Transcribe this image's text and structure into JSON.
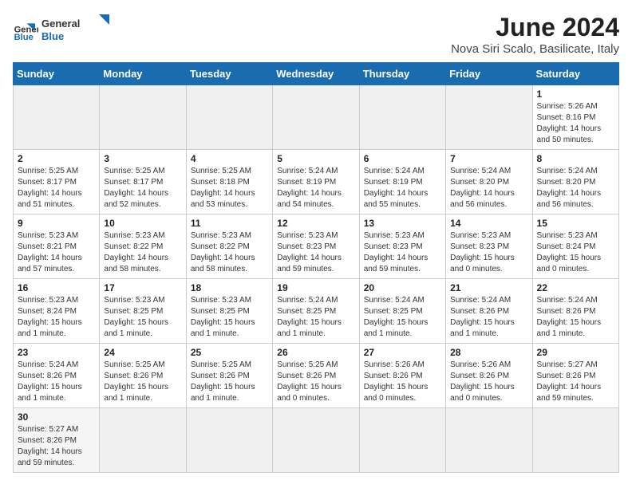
{
  "header": {
    "logo_general": "General",
    "logo_blue": "Blue",
    "title": "June 2024",
    "subtitle": "Nova Siri Scalo, Basilicate, Italy"
  },
  "weekdays": [
    "Sunday",
    "Monday",
    "Tuesday",
    "Wednesday",
    "Thursday",
    "Friday",
    "Saturday"
  ],
  "weeks": [
    [
      {
        "day": "",
        "info": ""
      },
      {
        "day": "",
        "info": ""
      },
      {
        "day": "",
        "info": ""
      },
      {
        "day": "",
        "info": ""
      },
      {
        "day": "",
        "info": ""
      },
      {
        "day": "",
        "info": ""
      },
      {
        "day": "1",
        "info": "Sunrise: 5:26 AM\nSunset: 8:16 PM\nDaylight: 14 hours\nand 50 minutes."
      }
    ],
    [
      {
        "day": "2",
        "info": "Sunrise: 5:25 AM\nSunset: 8:17 PM\nDaylight: 14 hours\nand 51 minutes."
      },
      {
        "day": "3",
        "info": "Sunrise: 5:25 AM\nSunset: 8:17 PM\nDaylight: 14 hours\nand 52 minutes."
      },
      {
        "day": "4",
        "info": "Sunrise: 5:25 AM\nSunset: 8:18 PM\nDaylight: 14 hours\nand 53 minutes."
      },
      {
        "day": "5",
        "info": "Sunrise: 5:24 AM\nSunset: 8:19 PM\nDaylight: 14 hours\nand 54 minutes."
      },
      {
        "day": "6",
        "info": "Sunrise: 5:24 AM\nSunset: 8:19 PM\nDaylight: 14 hours\nand 55 minutes."
      },
      {
        "day": "7",
        "info": "Sunrise: 5:24 AM\nSunset: 8:20 PM\nDaylight: 14 hours\nand 56 minutes."
      },
      {
        "day": "8",
        "info": "Sunrise: 5:24 AM\nSunset: 8:20 PM\nDaylight: 14 hours\nand 56 minutes."
      }
    ],
    [
      {
        "day": "9",
        "info": "Sunrise: 5:23 AM\nSunset: 8:21 PM\nDaylight: 14 hours\nand 57 minutes."
      },
      {
        "day": "10",
        "info": "Sunrise: 5:23 AM\nSunset: 8:22 PM\nDaylight: 14 hours\nand 58 minutes."
      },
      {
        "day": "11",
        "info": "Sunrise: 5:23 AM\nSunset: 8:22 PM\nDaylight: 14 hours\nand 58 minutes."
      },
      {
        "day": "12",
        "info": "Sunrise: 5:23 AM\nSunset: 8:23 PM\nDaylight: 14 hours\nand 59 minutes."
      },
      {
        "day": "13",
        "info": "Sunrise: 5:23 AM\nSunset: 8:23 PM\nDaylight: 14 hours\nand 59 minutes."
      },
      {
        "day": "14",
        "info": "Sunrise: 5:23 AM\nSunset: 8:23 PM\nDaylight: 15 hours\nand 0 minutes."
      },
      {
        "day": "15",
        "info": "Sunrise: 5:23 AM\nSunset: 8:24 PM\nDaylight: 15 hours\nand 0 minutes."
      }
    ],
    [
      {
        "day": "16",
        "info": "Sunrise: 5:23 AM\nSunset: 8:24 PM\nDaylight: 15 hours\nand 1 minute."
      },
      {
        "day": "17",
        "info": "Sunrise: 5:23 AM\nSunset: 8:25 PM\nDaylight: 15 hours\nand 1 minute."
      },
      {
        "day": "18",
        "info": "Sunrise: 5:23 AM\nSunset: 8:25 PM\nDaylight: 15 hours\nand 1 minute."
      },
      {
        "day": "19",
        "info": "Sunrise: 5:24 AM\nSunset: 8:25 PM\nDaylight: 15 hours\nand 1 minute."
      },
      {
        "day": "20",
        "info": "Sunrise: 5:24 AM\nSunset: 8:25 PM\nDaylight: 15 hours\nand 1 minute."
      },
      {
        "day": "21",
        "info": "Sunrise: 5:24 AM\nSunset: 8:26 PM\nDaylight: 15 hours\nand 1 minute."
      },
      {
        "day": "22",
        "info": "Sunrise: 5:24 AM\nSunset: 8:26 PM\nDaylight: 15 hours\nand 1 minute."
      }
    ],
    [
      {
        "day": "23",
        "info": "Sunrise: 5:24 AM\nSunset: 8:26 PM\nDaylight: 15 hours\nand 1 minute."
      },
      {
        "day": "24",
        "info": "Sunrise: 5:25 AM\nSunset: 8:26 PM\nDaylight: 15 hours\nand 1 minute."
      },
      {
        "day": "25",
        "info": "Sunrise: 5:25 AM\nSunset: 8:26 PM\nDaylight: 15 hours\nand 1 minute."
      },
      {
        "day": "26",
        "info": "Sunrise: 5:25 AM\nSunset: 8:26 PM\nDaylight: 15 hours\nand 0 minutes."
      },
      {
        "day": "27",
        "info": "Sunrise: 5:26 AM\nSunset: 8:26 PM\nDaylight: 15 hours\nand 0 minutes."
      },
      {
        "day": "28",
        "info": "Sunrise: 5:26 AM\nSunset: 8:26 PM\nDaylight: 15 hours\nand 0 minutes."
      },
      {
        "day": "29",
        "info": "Sunrise: 5:27 AM\nSunset: 8:26 PM\nDaylight: 14 hours\nand 59 minutes."
      }
    ],
    [
      {
        "day": "30",
        "info": "Sunrise: 5:27 AM\nSunset: 8:26 PM\nDaylight: 14 hours\nand 59 minutes."
      },
      {
        "day": "",
        "info": ""
      },
      {
        "day": "",
        "info": ""
      },
      {
        "day": "",
        "info": ""
      },
      {
        "day": "",
        "info": ""
      },
      {
        "day": "",
        "info": ""
      },
      {
        "day": "",
        "info": ""
      }
    ]
  ]
}
